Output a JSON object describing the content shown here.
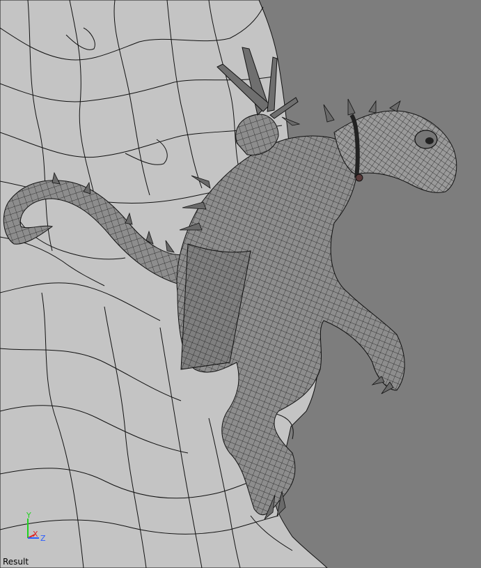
{
  "viewport": {
    "label": "Result",
    "background_color": "#7d7d7d",
    "mesh_fill": "#c4c4c4",
    "creature_fill": "#8d8d8d",
    "wire_color": "#111111"
  },
  "axis_gizmo": {
    "y_label": "Y",
    "x_label": "X",
    "z_label": "Z",
    "y_color": "#1fd21f",
    "x_color": "#e02020",
    "z_color": "#2a5cff"
  }
}
